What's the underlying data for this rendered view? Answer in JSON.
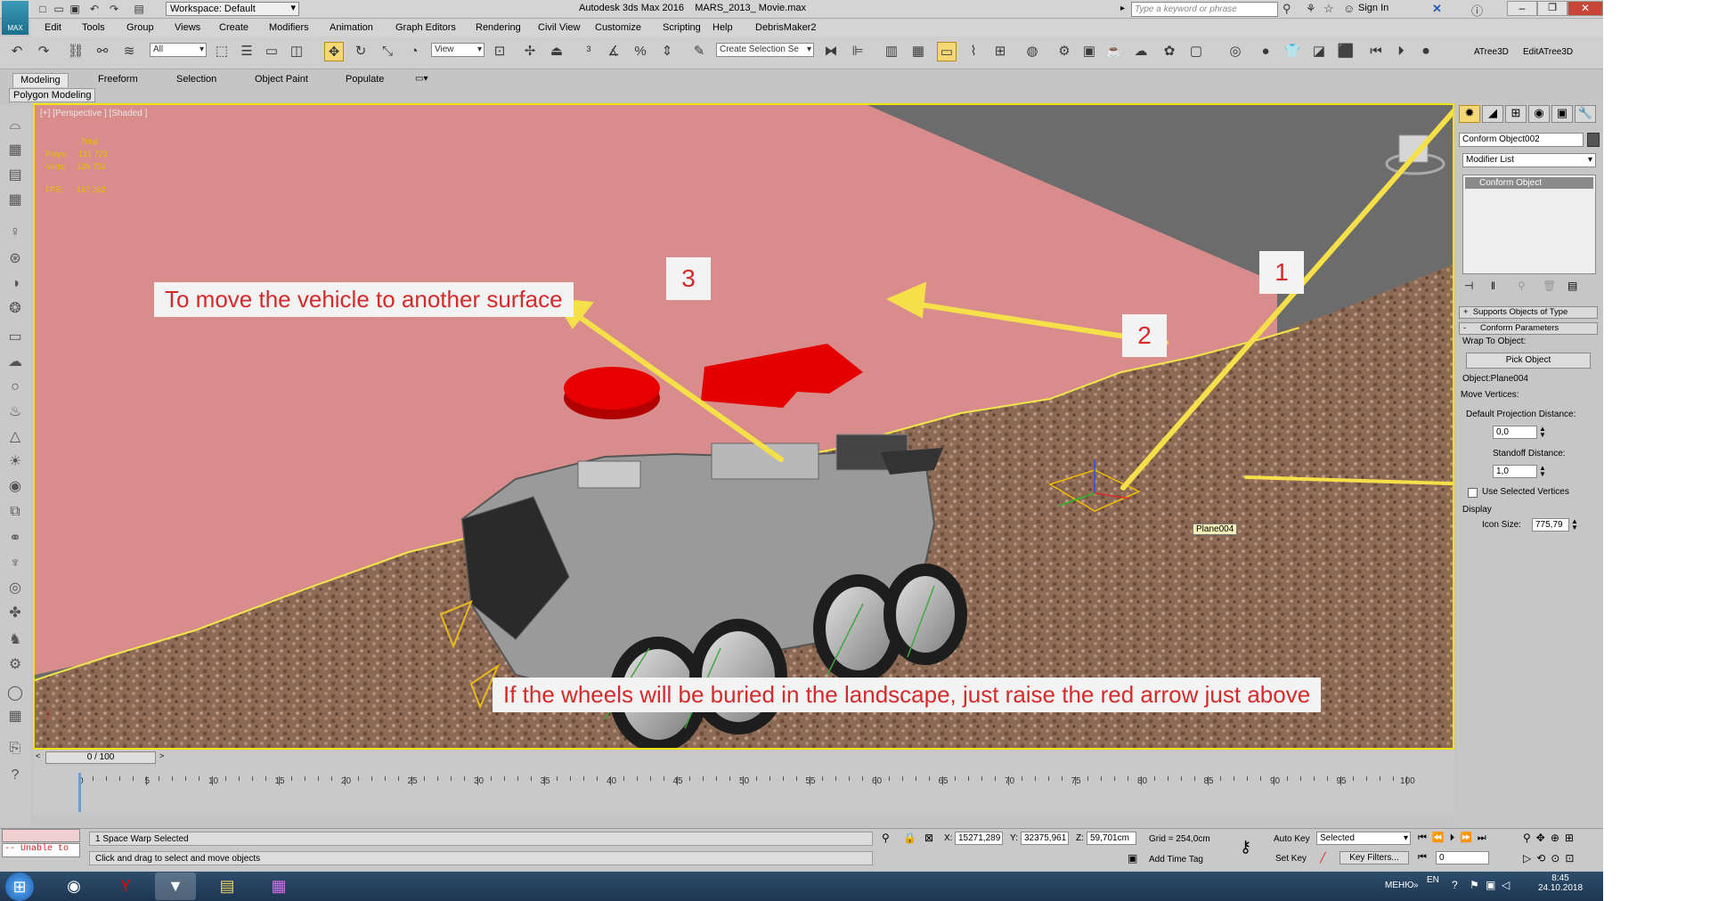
{
  "title_bar": {
    "app_title": "Autodesk 3ds Max 2016",
    "file_title": "MARS_2013_ Movie.max",
    "workspace_label": "Workspace: Default",
    "search_placeholder": "Type a keyword or phrase",
    "sign_in": "Sign In",
    "logo_text": "MAX"
  },
  "menu": [
    "Edit",
    "Tools",
    "Group",
    "Views",
    "Create",
    "Modifiers",
    "Animation",
    "Graph Editors",
    "Rendering",
    "Civil View",
    "Customize",
    "Scripting",
    "Help",
    "DebrisMaker2"
  ],
  "toolbar": {
    "selection_filter": "All",
    "ref_coord": "View",
    "named_selection_placeholder": "Create Selection Se",
    "plugins": [
      "ATree3D",
      "EditATree3D"
    ]
  },
  "ribbon": {
    "tabs": [
      "Modeling",
      "Freeform",
      "Selection",
      "Object Paint",
      "Populate"
    ],
    "active_tab": "Modeling",
    "panel": "Polygon Modeling"
  },
  "viewport": {
    "label": "[+] [Perspective ] [Shaded ]",
    "stats": {
      "total_label": "Total",
      "polys_label": "Polys:",
      "polys": "131 723",
      "verts_label": "Verts:",
      "verts": "129 702",
      "fps_label": "FPS:",
      "fps": "167,362"
    },
    "annotations": {
      "caption1": "To move the vehicle to another surface",
      "caption2": "If the wheels will be buried in the landscape, just raise the red arrow just above",
      "numbers": [
        "1",
        "2",
        "3"
      ]
    },
    "object_tag": "Plane004",
    "colors": {
      "accent_border": "#f1e300",
      "callout_arrow": "#f7e24a",
      "caption_text": "#d42a2a",
      "red_gizmo": "#e80000",
      "pink_plane": "#d98a8a"
    }
  },
  "command_panel": {
    "object_name": "Conform Object002",
    "modifier_list": "Modifier List",
    "stack_item": "Conform Object",
    "rollouts": {
      "supports": "Supports Objects of Type",
      "conform_params": "Conform Parameters",
      "wrap_to_object": "Wrap To Object:",
      "pick_object": "Pick Object",
      "object_label": "Object:Plane004",
      "move_vertices": "Move Vertices:",
      "default_projection_label": "Default Projection Distance:",
      "default_projection_value": "0,0",
      "standoff_label": "Standoff Distance:",
      "standoff_value": "1,0",
      "use_selected": "Use Selected Vertices",
      "display_label": "Display",
      "icon_size_label": "Icon Size:",
      "icon_size_value": "775,79"
    }
  },
  "timeline": {
    "frame_counter": "0 / 100",
    "ticks": [
      "0",
      "5",
      "10",
      "15",
      "20",
      "25",
      "30",
      "35",
      "40",
      "45",
      "50",
      "55",
      "60",
      "65",
      "70",
      "75",
      "80",
      "85",
      "90",
      "95",
      "100"
    ]
  },
  "status": {
    "selection": "1 Space Warp Selected",
    "prompt": "Click and drag to select and move objects",
    "x_label": "X:",
    "x": "15271,289",
    "y_label": "Y:",
    "y": "32375,961",
    "z_label": "Z:",
    "z": "59,701cm",
    "grid": "Grid = 254,0cm",
    "add_time_tag": "Add Time Tag",
    "auto_key": "Auto Key",
    "set_key": "Set Key",
    "key_mode": "Selected",
    "key_filters": "Key Filters...",
    "frame": "0",
    "maxscript_error": "-- Unable to"
  },
  "taskbar": {
    "lang": "EN",
    "menu_text": "МЕНЮ",
    "time": "8:45",
    "date": "24.10.2018"
  }
}
